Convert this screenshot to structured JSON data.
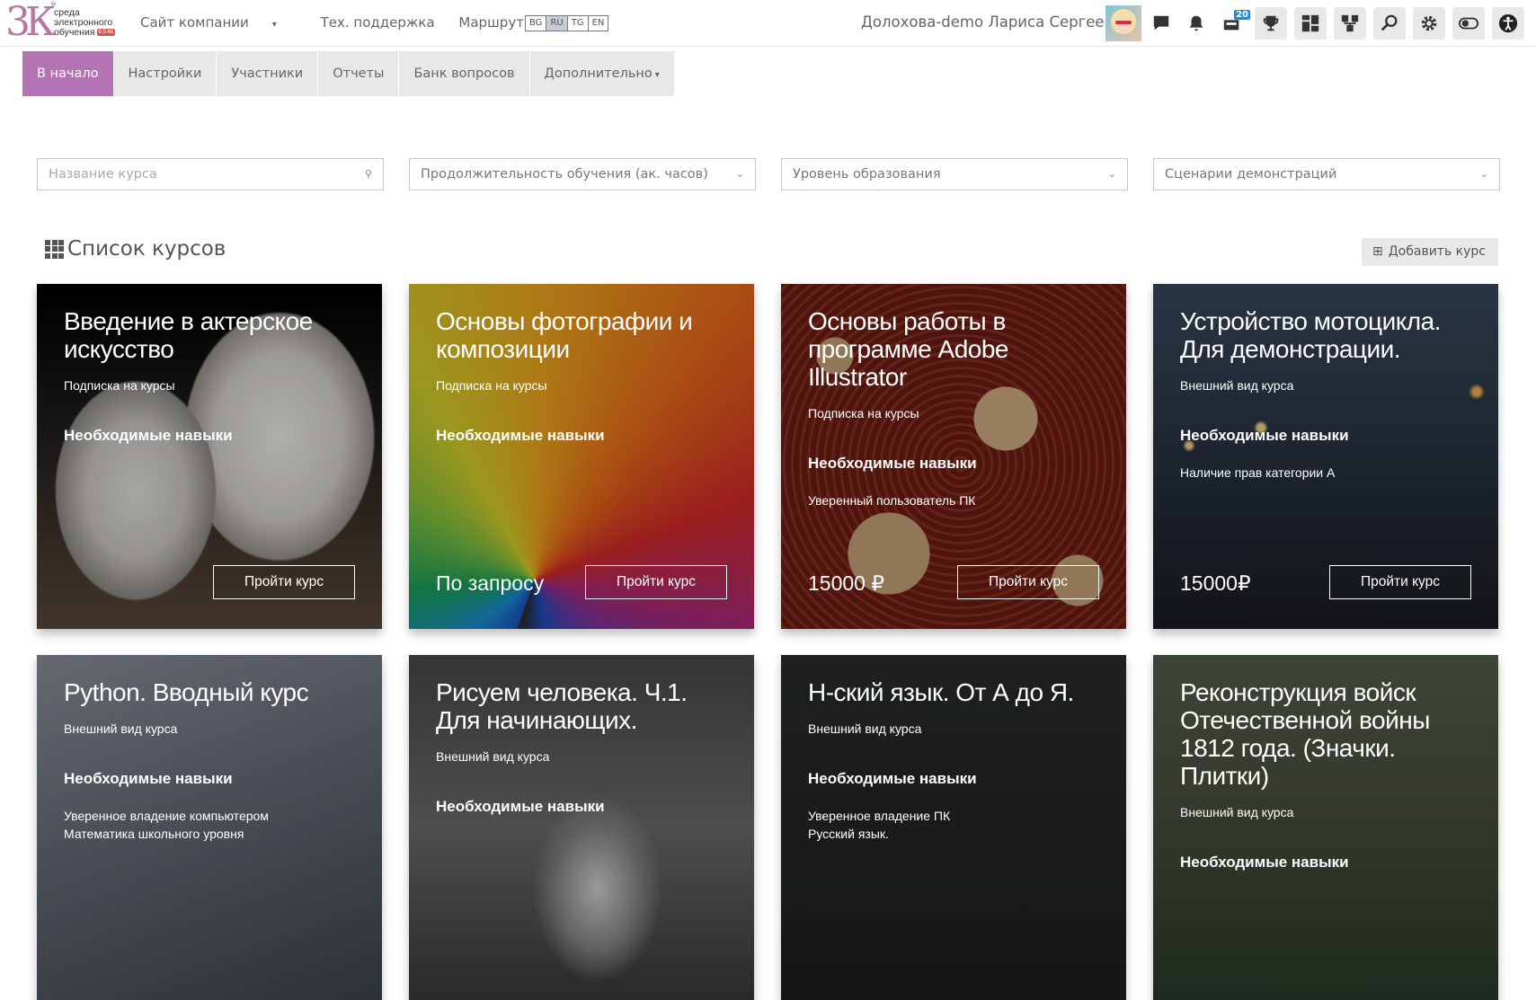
{
  "header": {
    "logo_mark": "3К",
    "logo_text_1": "среда",
    "logo_text_2": "электронного",
    "logo_text_3": "обучения",
    "logo_version": "6.5.6b",
    "nav": [
      {
        "label": "Сайт компании"
      },
      {
        "label": "Тех. поддержка"
      },
      {
        "label": "Маршрут внедрения"
      }
    ],
    "languages": [
      {
        "code": "BG",
        "active": false
      },
      {
        "code": "RU",
        "active": true
      },
      {
        "code": "TG",
        "active": false
      },
      {
        "code": "EN",
        "active": false
      }
    ],
    "user_name": "Долохова-demo Лариса Сергеевна",
    "notification_badge": "20",
    "icons": [
      "chat-icon",
      "bell-icon",
      "badge-icon",
      "trophy-icon",
      "dashboard-icon",
      "org-structure-icon",
      "search-icon",
      "gear-icon",
      "toggle-icon",
      "accessibility-icon"
    ]
  },
  "menu": {
    "items": [
      {
        "label": "В начало",
        "active": true
      },
      {
        "label": "Настройки",
        "active": false
      },
      {
        "label": "Участники",
        "active": false
      },
      {
        "label": "Отчеты",
        "active": false
      },
      {
        "label": "Банк вопросов",
        "active": false
      },
      {
        "label": "Дополнительно",
        "active": false
      }
    ]
  },
  "filters": {
    "course_name_placeholder": "Название курса",
    "duration": "Продолжительность обучения (ак. часов)",
    "education_level": "Уровень образования",
    "demo_scenarios": "Сценарии демонстраций"
  },
  "list": {
    "title": "Список курсов",
    "add_button": "Добавить курс"
  },
  "courses": [
    {
      "title": "Введение в актерское искусство",
      "subtitle": "Подписка на курсы",
      "skills_heading": "Необходимые навыки",
      "skills": [],
      "price": "",
      "button": "Пройти курс"
    },
    {
      "title": "Основы фотографии и композиции",
      "subtitle": "Подписка на курсы",
      "skills_heading": "Необходимые навыки",
      "skills": [],
      "price": "По запросу",
      "button": "Пройти курс"
    },
    {
      "title": "Основы работы в программе Adobe Illustrator",
      "subtitle": "Подписка на курсы",
      "skills_heading": "Необходимые навыки",
      "skills": [
        "Уверенный пользователь ПК"
      ],
      "price": "15000 ₽",
      "button": "Пройти курс"
    },
    {
      "title": "Устройство мотоцикла. Для демонстрации.",
      "subtitle": "Внешний вид курса",
      "skills_heading": "Необходимые навыки",
      "skills": [
        "Наличие прав категории А"
      ],
      "price": "15000₽",
      "button": "Пройти курс"
    },
    {
      "title": "Python. Вводный курс",
      "subtitle": "Внешний вид курса",
      "skills_heading": "Необходимые навыки",
      "skills": [
        "Уверенное владение компьютером",
        "Математика школьного уровня"
      ],
      "price": "",
      "button": ""
    },
    {
      "title": "Рисуем человека. Ч.1. Для начинающих.",
      "subtitle": "Внешний вид курса",
      "skills_heading": "Необходимые навыки",
      "skills": [],
      "price": "",
      "button": ""
    },
    {
      "title": "Н-ский язык. От А до Я.",
      "subtitle": "Внешний вид курса",
      "skills_heading": "Необходимые навыки",
      "skills": [
        "Уверенное владение ПК",
        "Русский язык."
      ],
      "price": "",
      "button": ""
    },
    {
      "title": "Реконструкция войск Отечественной войны 1812 года. (Значки. Плитки)",
      "subtitle": "Внешний вид курса",
      "skills_heading": "Необходимые навыки",
      "skills": [],
      "price": "",
      "button": ""
    }
  ]
}
